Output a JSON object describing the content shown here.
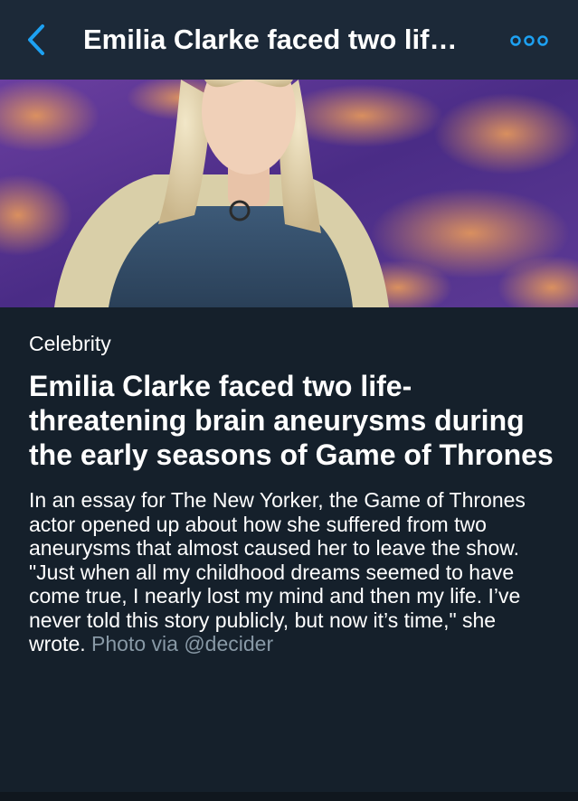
{
  "header": {
    "title": "Emilia Clarke faced two lif…",
    "back_icon": "chevron-left-icon",
    "more_icon": "more-options-icon",
    "accent": "#1da1f2"
  },
  "hero": {
    "image": "photo-emilia-clarke"
  },
  "article": {
    "category": "Celebrity",
    "headline": "Emilia Clarke faced two life-threatening brain aneurysms during the early seasons of Game of Thrones",
    "body": "In an essay for The New Yorker, the Game of Thrones actor opened up about how she suffered from two aneurysms that almost caused her to leave the show. \"Just when all my childhood dreams seemed to have come true, I nearly lost my mind and then my life. I’ve never told this story publicly, but now it’s time,\" she wrote.",
    "credit": "Photo via @decider"
  },
  "colors": {
    "background": "#15202b",
    "header_bg": "#1c2938",
    "text": "#ffffff",
    "muted": "#8899a6"
  }
}
